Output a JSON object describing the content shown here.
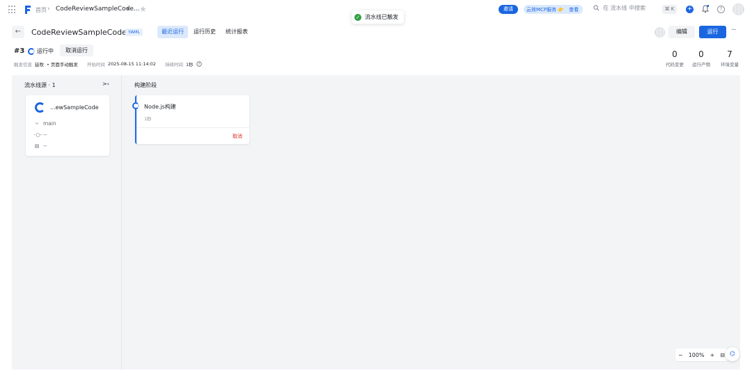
{
  "topbar": {
    "breadcrumb_home": "首页",
    "breadcrumb_sep": "›",
    "breadcrumb_current": "CodeReviewSampleCode...",
    "invite_label": "邀请",
    "mcp_label": "云效MCP服务 👉",
    "mcp_view": "查看",
    "search_placeholder": "在 流水线 中搜索",
    "shortcut": "⌘ K"
  },
  "toast": {
    "text": "流水线已触发"
  },
  "header": {
    "title": "CodeReviewSampleCode-CI",
    "badge": "YAML",
    "tabs": [
      {
        "label": "最近运行"
      },
      {
        "label": "运行历史"
      },
      {
        "label": "统计报表"
      }
    ],
    "edit_label": "编辑",
    "run_label": "运行",
    "more_label": "···"
  },
  "run": {
    "number": "#3",
    "status": "运行中",
    "cancel_label": "取消运行",
    "trigger_label": "触发信息",
    "trigger_user": "延牧",
    "trigger_method": "• 页面手动触发",
    "start_label": "开始时间",
    "start_time": "2025-08-15 11:14:02",
    "duration_label": "持续时间",
    "duration": "1秒"
  },
  "stats": [
    {
      "value": "0",
      "label": "代码变更"
    },
    {
      "value": "0",
      "label": "运行产物"
    },
    {
      "value": "7",
      "label": "环境变量"
    }
  ],
  "source": {
    "header": "流水线源 · 1",
    "collapse": ">‹",
    "repo_name": "...ewSampleCode",
    "branch": "main",
    "commit": "--",
    "message": "--"
  },
  "stage": {
    "header": "构建阶段",
    "job_name": "Node.js构建",
    "job_duration": "1秒",
    "job_cancel": "取消"
  },
  "zoom": {
    "minus": "−",
    "level": "100%",
    "plus": "+"
  },
  "colors": {
    "accent": "#1a66e0",
    "danger": "#d92d20",
    "canvas": "#f2f4f6"
  }
}
